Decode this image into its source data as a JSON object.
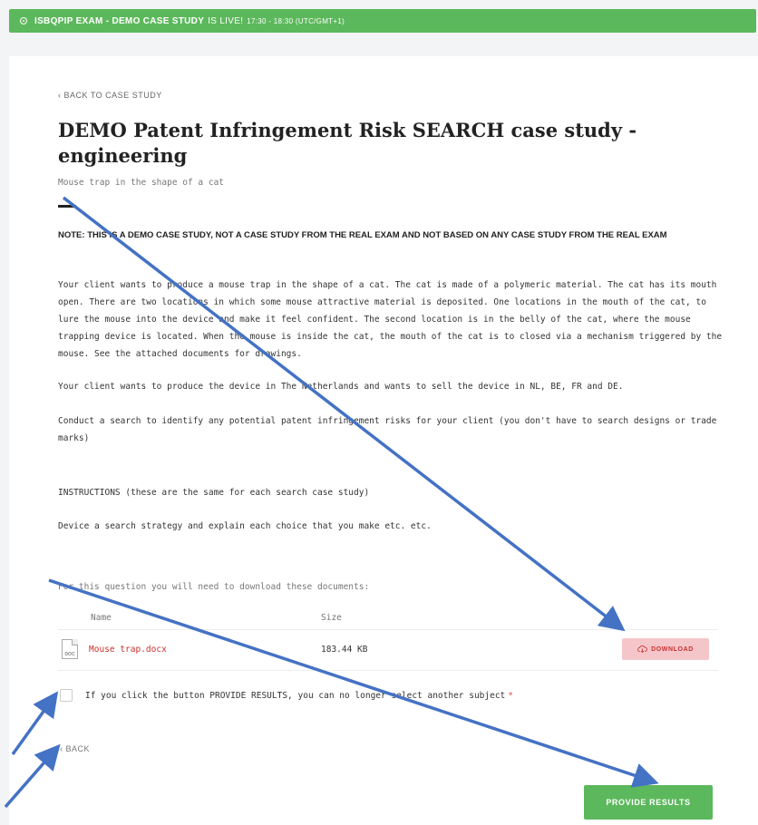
{
  "banner": {
    "exam": "ISBQPIP EXAM - DEMO CASE STUDY",
    "live": "IS LIVE!",
    "time": "17:30 - 18:30 (UTC/GMT+1)",
    "color": "#5cb85c"
  },
  "nav": {
    "back_to_case_study": "‹ BACK TO CASE STUDY",
    "back": "‹ BACK"
  },
  "case": {
    "title": "DEMO Patent Infringement Risk SEARCH case study - engineering",
    "subtitle": "Mouse trap in the shape of a cat",
    "note": "NOTE: THIS IS A DEMO CASE STUDY, NOT A CASE STUDY FROM THE REAL EXAM AND NOT BASED ON ANY CASE STUDY FROM THE REAL EXAM",
    "paragraphs": [
      "Your client wants to produce a mouse trap in the shape of a cat. The cat is made of a polymeric material. The cat has its mouth open. There are two locations in which some mouse attractive material is deposited. One locations in the mouth of the cat, to lure the mouse into the device and make it feel confident. The second location is in the belly of the cat, where the mouse trapping device is located. When the mouse is inside the cat, the mouth of the cat is to closed via a mechanism triggered by the mouse. See the attached documents for drawings.",
      "Your client wants to produce the device in The Netherlands and wants to sell the device in NL, BE, FR and DE.",
      "Conduct a search to identify any potential patent infringement risks for your client (you don't have to search designs or trade marks)",
      "INSTRUCTIONS (these are the same for each search case study)",
      "Device a search strategy and explain each choice that you make etc. etc.",
      "For this question you will need to download these documents:"
    ]
  },
  "files": {
    "columns": [
      "Name",
      "Size"
    ],
    "rows": [
      {
        "icon_text": "DOC",
        "name": "Mouse trap.docx",
        "size": "183.44 KB",
        "action": "DOWNLOAD"
      }
    ]
  },
  "consent": {
    "label": "If you click the button PROVIDE RESULTS, you can no longer select another subject",
    "required_mark": "*",
    "checked": false
  },
  "actions": {
    "provide_results": "PROVIDE RESULTS"
  },
  "colors": {
    "accent_green": "#5cb85c",
    "danger_red": "#c9302c",
    "download_bg": "#f5c6c9",
    "arrow_blue": "#4472c4"
  }
}
